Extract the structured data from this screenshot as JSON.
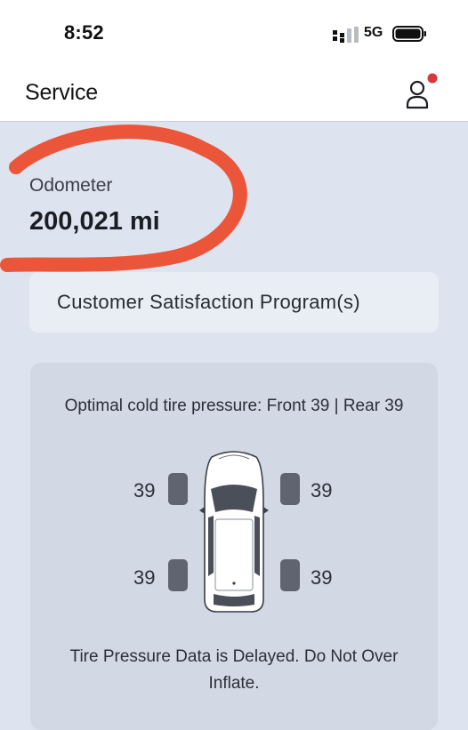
{
  "status_bar": {
    "time": "8:52",
    "network": "5G",
    "icons": [
      "signal-icon",
      "battery-icon"
    ]
  },
  "header": {
    "title": "Service",
    "account_icon": "person-icon",
    "notification_dot_color": "#d9383a"
  },
  "odometer": {
    "label": "Odometer",
    "value": "200,021 mi"
  },
  "customer_satisfaction": {
    "label": "Customer Satisfaction Program(s)"
  },
  "tire_pressure": {
    "optimal_text": "Optimal cold tire pressure: Front 39 | Rear 39",
    "front_left": "39",
    "front_right": "39",
    "rear_left": "39",
    "rear_right": "39",
    "note": "Tire Pressure Data is Delayed. Do Not Over Inflate."
  },
  "colors": {
    "background": "#dde3ef",
    "card": "#e9edf4",
    "tire_card": "#d2d8e4",
    "tire": "#5f6470",
    "annotation": "#ec4a2a"
  }
}
